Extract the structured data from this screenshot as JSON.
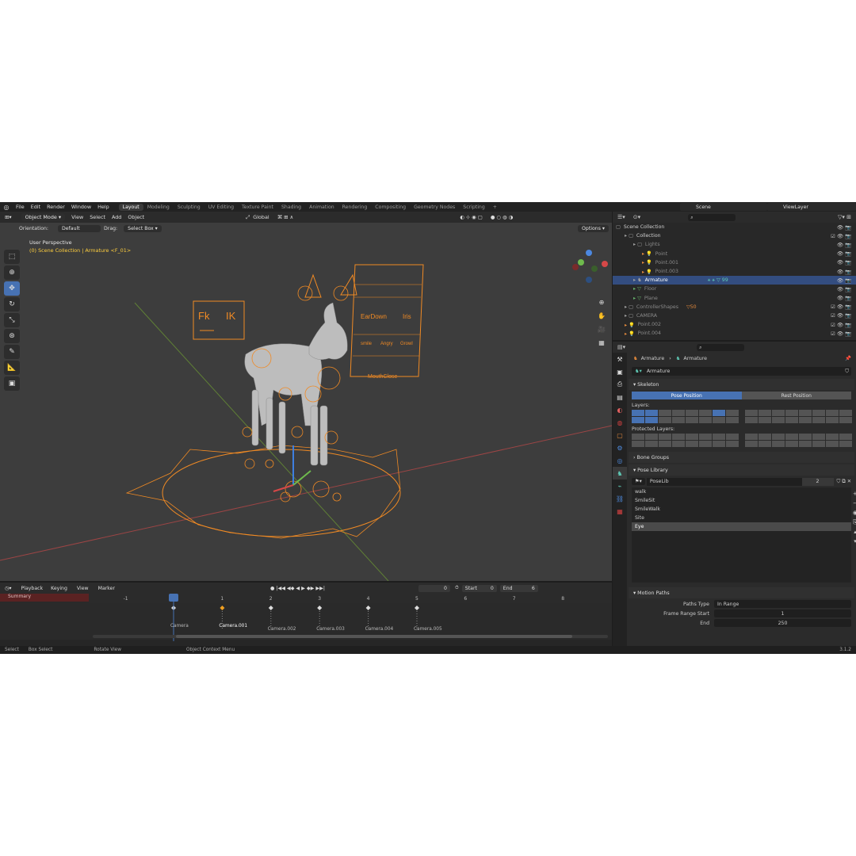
{
  "topbar": {
    "menus": [
      "File",
      "Edit",
      "Render",
      "Window",
      "Help"
    ],
    "tabs": [
      "Layout",
      "Modeling",
      "Sculpting",
      "UV Editing",
      "Texture Paint",
      "Shading",
      "Animation",
      "Rendering",
      "Compositing",
      "Geometry Nodes",
      "Scripting"
    ],
    "active_tab": "Layout",
    "scene": "Scene",
    "view_layer": "ViewLayer"
  },
  "viewport": {
    "mode": "Object Mode",
    "menus": [
      "View",
      "Select",
      "Add",
      "Object"
    ],
    "transform_space": "Global",
    "orientation_label": "Orientation:",
    "orientation_value": "Default",
    "drag_label": "Drag:",
    "drag_value": "Select Box",
    "options": "Options",
    "info_line1": "User Perspective",
    "info_line2": "(0) Scene Collection | Armature <F_01>",
    "rig_labels": {
      "fk": "Fk",
      "ik": "IK",
      "eardown": "EarDown",
      "iris": "Iris",
      "smile": "smile",
      "angry": "Angry",
      "growl": "Growl",
      "mouthclose": "MouthClose"
    },
    "colors": {
      "bone_orange": "#ff8c1a",
      "grid_red": "#b84a4a",
      "grid_green": "#6a8e3a",
      "bg": "#3d3d3d"
    }
  },
  "timeline": {
    "menus": [
      "Playback",
      "Keying",
      "View",
      "Marker"
    ],
    "current_frame": "0",
    "start_label": "Start",
    "start": "0",
    "end_label": "End",
    "end": "6",
    "ruler": [
      "-1",
      "0",
      "1",
      "2",
      "3",
      "4",
      "5",
      "6",
      "7",
      "8"
    ],
    "summary": "Summary",
    "markers": [
      "Camera",
      "Camera.001",
      "Camera.002",
      "Camera.003",
      "Camera.004",
      "Camera.005"
    ]
  },
  "statusbar": {
    "items": [
      "Select",
      "Box Select",
      "Rotate View",
      "Object Context Menu"
    ],
    "version": "3.1.2"
  },
  "outliner": {
    "rows": [
      {
        "name": "Scene Collection",
        "indent": 0
      },
      {
        "name": "Collection",
        "indent": 1
      },
      {
        "name": "Lights",
        "indent": 2
      },
      {
        "name": "Point",
        "indent": 3
      },
      {
        "name": "Point.001",
        "indent": 3
      },
      {
        "name": "Point.003",
        "indent": 3
      },
      {
        "name": "Armature",
        "indent": 2
      },
      {
        "name": "Floor",
        "indent": 2
      },
      {
        "name": "Plane",
        "indent": 2
      },
      {
        "name": "ControllerShapes",
        "indent": 1
      },
      {
        "name": "CAMERA",
        "indent": 1
      },
      {
        "name": "Point.002",
        "indent": 1
      },
      {
        "name": "Point.004",
        "indent": 1
      }
    ],
    "armature_extra": "99",
    "controller_count": "50"
  },
  "properties": {
    "breadcrumb_a": "Armature",
    "breadcrumb_b": "Armature",
    "datablock": "Armature",
    "skeleton": "Skeleton",
    "pose_position": "Pose Position",
    "rest_position": "Rest Position",
    "layers": "Layers:",
    "protected_layers": "Protected Layers:",
    "bone_groups": "Bone Groups",
    "pose_library": "Pose Library",
    "poselib_name": "PoseLib",
    "poselib_users": "2",
    "poses": [
      "walk",
      "SmileSit",
      "SmileWalk",
      "Site",
      "Eye"
    ],
    "selected_pose": "Eye",
    "motion_paths": "Motion Paths",
    "paths_type_label": "Paths Type",
    "paths_type_value": "In Range",
    "frame_range_start_label": "Frame Range Start",
    "frame_range_start_value": "1",
    "end_label": "End",
    "end_value": "250"
  }
}
